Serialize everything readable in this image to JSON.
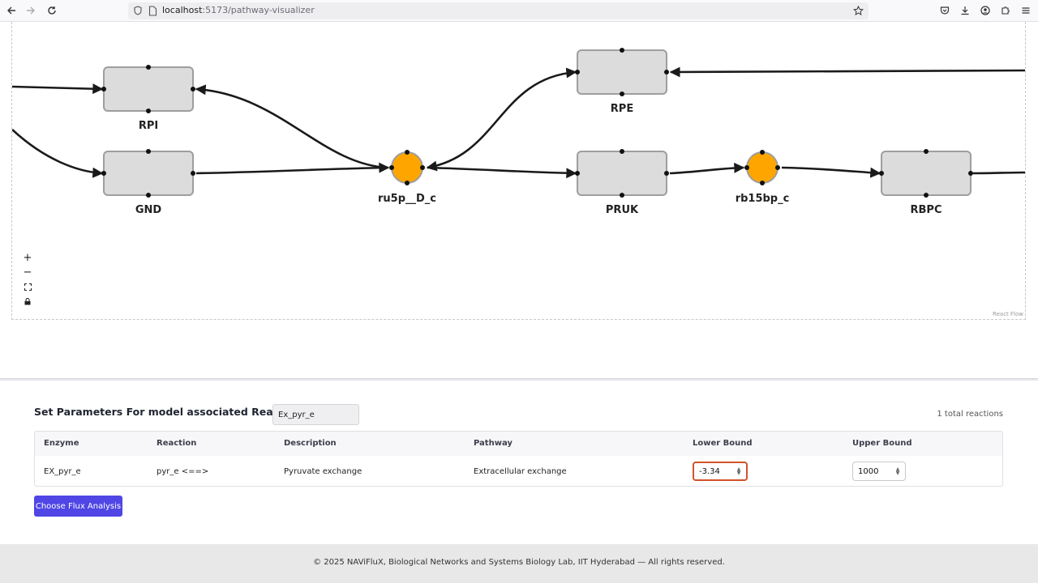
{
  "browser": {
    "url_host": "localhost",
    "url_path": ":5173/pathway-visualizer"
  },
  "flow": {
    "nodes": {
      "rpi": "RPI",
      "gnd": "GND",
      "rpe": "RPE",
      "pruk": "PRUK",
      "rbpc": "RBPC",
      "ru5p": "ru5p__D_c",
      "rb15bp": "rb15bp_c"
    },
    "controls": {
      "zoom_in": "+",
      "zoom_out": "−"
    },
    "attribution": "React Flow",
    "colors": {
      "reaction_fill": "#dcdcdc",
      "reaction_border": "#9e9e9e",
      "metabolite_fill": "#ffa500",
      "edge": "#1a1a1a"
    }
  },
  "params": {
    "title": "Set Parameters For model associated Reactions",
    "filter_value": "Ex_pyr_e",
    "total_label": "1 total reactions",
    "columns": {
      "enzyme": "Enzyme",
      "reaction": "Reaction",
      "description": "Description",
      "pathway": "Pathway",
      "lower": "Lower Bound",
      "upper": "Upper Bound"
    },
    "rows": [
      {
        "enzyme": "EX_pyr_e",
        "reaction": "pyr_e <==>",
        "description": "Pyruvate exchange",
        "pathway": "Extracellular exchange",
        "lower_bound": "-3.34",
        "upper_bound": "1000"
      }
    ],
    "button_label": "Choose Flux Analysis",
    "accent_color": "#4f46e5",
    "focus_color": "#d2532b"
  },
  "footer": {
    "text": "© 2025 NAViFluX, Biological Networks and Systems Biology Lab, IIT Hyderabad — All rights reserved."
  }
}
